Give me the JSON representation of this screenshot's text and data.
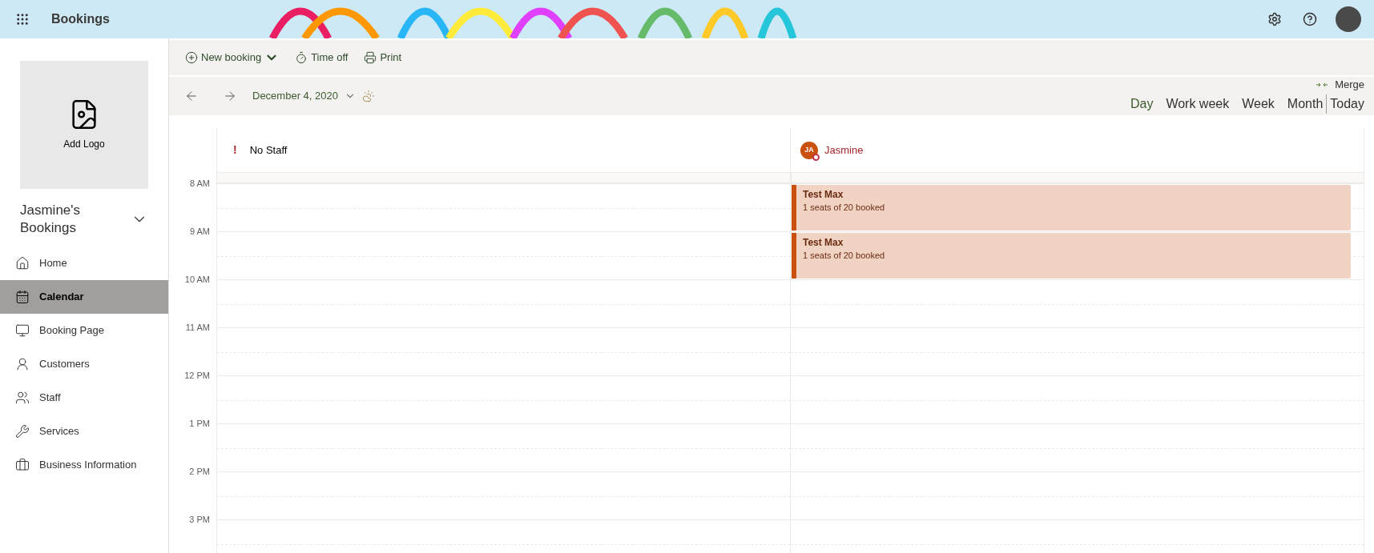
{
  "app_bar": {
    "title": "Bookings"
  },
  "sidebar": {
    "logo_label": "Add Logo",
    "business_name": "Jasmine's Bookings",
    "items": [
      {
        "label": "Home",
        "selected": false
      },
      {
        "label": "Calendar",
        "selected": true
      },
      {
        "label": "Booking Page",
        "selected": false
      },
      {
        "label": "Customers",
        "selected": false
      },
      {
        "label": "Staff",
        "selected": false
      },
      {
        "label": "Services",
        "selected": false
      },
      {
        "label": "Business Information",
        "selected": false
      }
    ]
  },
  "toolbar": {
    "actions": [
      {
        "label": "New booking",
        "kind": "new"
      },
      {
        "label": "Time off",
        "kind": "timeoff"
      },
      {
        "label": "Print",
        "kind": "print"
      }
    ]
  },
  "date_bar": {
    "date": "December 4, 2020",
    "merge": "Merge",
    "views": [
      {
        "label": "Day",
        "selected": true
      },
      {
        "label": "Work week",
        "selected": false
      },
      {
        "label": "Week",
        "selected": false
      },
      {
        "label": "Month",
        "selected": false
      }
    ],
    "today": "Today"
  },
  "calendar": {
    "columns": [
      {
        "kind": "unassigned",
        "mark": "!",
        "name": "No Staff"
      },
      {
        "kind": "staff",
        "initials": "JA",
        "name": "Jasmine"
      }
    ],
    "hours": [
      {
        "label": "8 AM",
        "staff_booking": {
          "title": "Test Max",
          "detail": "1 seats of 20 booked"
        }
      },
      {
        "label": "9 AM",
        "staff_booking": {
          "title": "Test Max",
          "detail": "1 seats of 20 booked"
        }
      },
      {
        "label": "10 AM"
      },
      {
        "label": "11 AM"
      },
      {
        "label": "12 PM"
      },
      {
        "label": "1 PM"
      },
      {
        "label": "2 PM"
      },
      {
        "label": "3 PM"
      }
    ]
  }
}
